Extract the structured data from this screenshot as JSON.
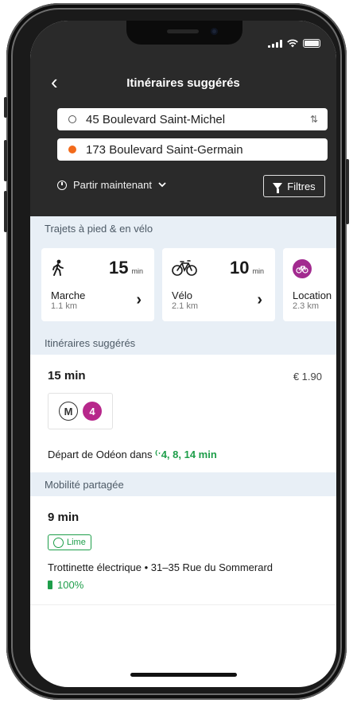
{
  "header": {
    "title": "Itinéraires suggérés",
    "origin": "45 Boulevard Saint-Michel",
    "destination": "173 Boulevard Saint-Germain",
    "depart_option": "Partir maintenant",
    "filters_label": "Filtres"
  },
  "walk_bike": {
    "title": "Trajets à pied & en vélo",
    "cards": [
      {
        "mode": "Marche",
        "time": "15",
        "unit": "min",
        "distance": "1.1 km",
        "icon": "walking-icon"
      },
      {
        "mode": "Vélo",
        "time": "10",
        "unit": "min",
        "distance": "2.1 km",
        "icon": "bicycle-icon"
      },
      {
        "mode": "Location",
        "distance": "2.3 km",
        "icon": "bike-rental-icon"
      }
    ]
  },
  "suggested": {
    "title": "Itinéraires suggérés",
    "duration": "15 min",
    "price": "€ 1.90",
    "metro_letter": "M",
    "line": "4",
    "departure_prefix": "Départ de Odéon dans",
    "live_times": "4, 8, 14 min"
  },
  "shared_mobility": {
    "title": "Mobilité partagée",
    "duration": "9 min",
    "brand": "Lime",
    "description": "Trottinette électrique • 31–35 Rue du Sommerard",
    "battery": "100%"
  },
  "colors": {
    "header_bg": "#2a2a2a",
    "destination_dot": "#f26a1b",
    "accent_green": "#1e9e4a",
    "line4": "#b7278b",
    "section_bg": "#e8eff6"
  }
}
